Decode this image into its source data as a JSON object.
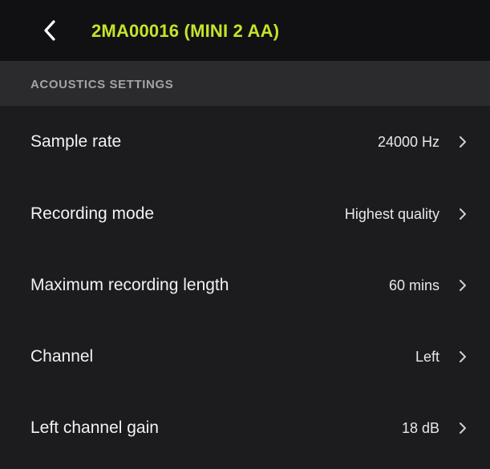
{
  "header": {
    "back_icon": "chevron-left-icon",
    "title": "2MA00016 (MINI 2 AA)",
    "title_color": "#c8e22a"
  },
  "section": {
    "title": "ACOUSTICS SETTINGS"
  },
  "settings": [
    {
      "label": "Sample rate",
      "value": "24000 Hz",
      "icon": "chevron-right-icon"
    },
    {
      "label": "Recording mode",
      "value": "Highest quality",
      "icon": "chevron-right-icon"
    },
    {
      "label": "Maximum recording length",
      "value": "60 mins",
      "icon": "chevron-right-icon"
    },
    {
      "label": "Channel",
      "value": "Left",
      "icon": "chevron-right-icon"
    },
    {
      "label": "Left channel gain",
      "value": "18 dB",
      "icon": "chevron-right-icon"
    }
  ]
}
